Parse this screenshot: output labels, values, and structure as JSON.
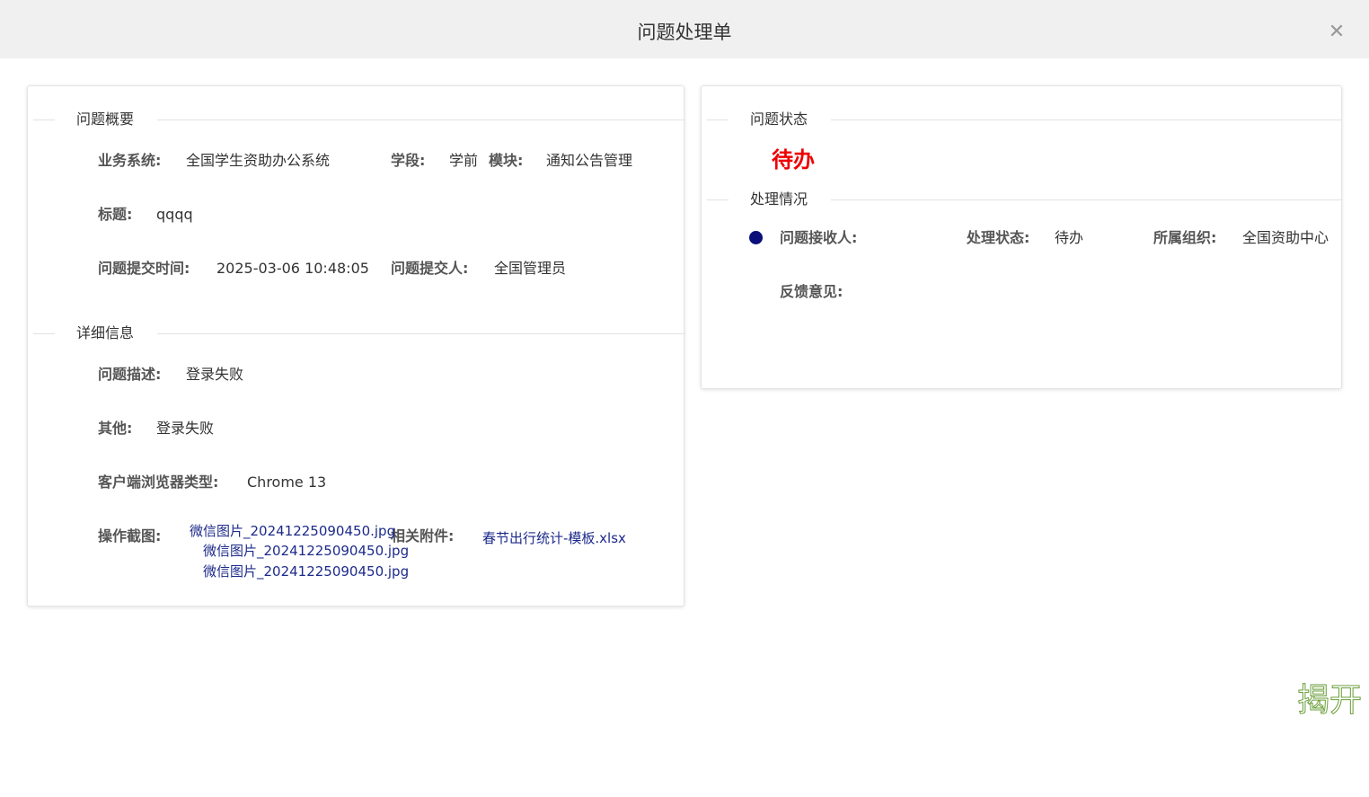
{
  "modal": {
    "title": "问题处理单",
    "close_icon": "close-icon"
  },
  "overview": {
    "section_title": "问题概要",
    "system_label": "业务系统:",
    "system_value": "全国学生资助办公系统",
    "stage_label": "学段:",
    "stage_value": "学前",
    "module_label": "模块:",
    "module_value": "通知公告管理",
    "title_label": "标题:",
    "title_value": "qqqq",
    "time_label": "问题提交时间:",
    "time_value": "2025-03-06 10:48:05",
    "submitter_label": "问题提交人:",
    "submitter_value": "全国管理员"
  },
  "details": {
    "section_title": "详细信息",
    "desc_label": "问题描述:",
    "desc_value": "登录失败",
    "other_label": "其他:",
    "other_value": "登录失败",
    "browser_label": "客户端浏览器类型:",
    "browser_value": "Chrome 13",
    "screenshot_label": "操作截图:",
    "screenshots": [
      "微信图片_20241225090450.jpg",
      "微信图片_20241225090450.jpg",
      "微信图片_20241225090450.jpg"
    ],
    "attachment_label": "相关附件:",
    "attachment_value": "春节出行统计-模板.xlsx"
  },
  "status": {
    "section_title": "问题状态",
    "value": "待办",
    "value_color": "#ee0000"
  },
  "handling": {
    "section_title": "处理情况",
    "receiver_label": "问题接收人:",
    "receiver_value": "",
    "state_label": "处理状态:",
    "state_value": "待办",
    "org_label": "所属组织:",
    "org_value": "全国资助中心",
    "feedback_label": "反馈意见:",
    "feedback_value": ""
  },
  "watermark": {
    "text": "揭开"
  }
}
